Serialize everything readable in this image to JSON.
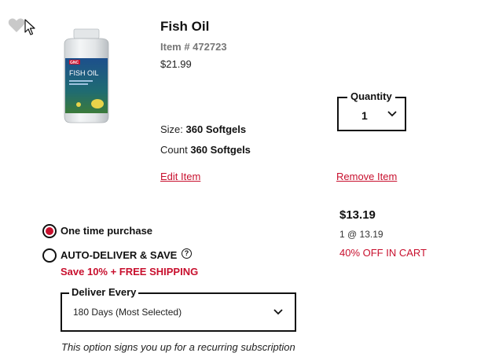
{
  "product": {
    "title": "Fish Oil",
    "item_number": "Item # 472723",
    "price": "$21.99",
    "image_label_brand": "GNC",
    "image_label_name": "FISH OIL"
  },
  "attributes": {
    "size_label": "Size:",
    "size_value": "360 Softgels",
    "count_label": "Count",
    "count_value": "360 Softgels"
  },
  "actions": {
    "edit": "Edit Item",
    "remove": "Remove Item"
  },
  "quantity": {
    "label": "Quantity",
    "value": "1"
  },
  "pricing": {
    "subtotal": "$13.19",
    "unit": "1 @ 13.19",
    "discount": "40% OFF IN CART"
  },
  "purchase_options": {
    "one_time": "One time purchase",
    "auto_deliver": "AUTO-DELIVER & SAVE",
    "auto_help": "?",
    "promo": "Save 10% + FREE SHIPPING",
    "selected": "one_time"
  },
  "delivery": {
    "label": "Deliver Every",
    "value": "180 Days (Most Selected)",
    "note": "This option signs you up for a recurring subscription"
  },
  "colors": {
    "accent": "#c8102e",
    "text": "#111111",
    "muted": "#777777"
  }
}
